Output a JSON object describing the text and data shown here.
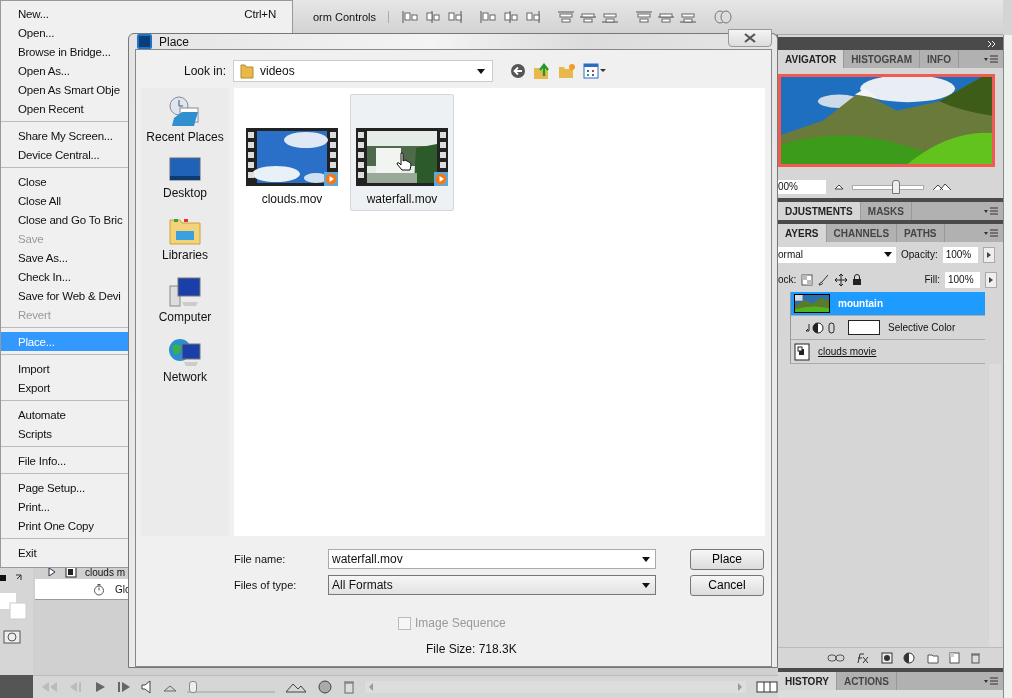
{
  "options_bar": {
    "label": "orm Controls"
  },
  "file_menu": {
    "groups": [
      [
        {
          "label": "New...",
          "shortcut": "Ctrl+N",
          "disabled": false,
          "selected": false
        },
        {
          "label": "Open...",
          "disabled": false,
          "selected": false
        },
        {
          "label": "Browse in Bridge...",
          "disabled": false,
          "selected": false
        },
        {
          "label": "Open As...",
          "disabled": false,
          "selected": false
        },
        {
          "label": "Open As Smart Obje",
          "disabled": false,
          "selected": false
        },
        {
          "label": "Open Recent",
          "disabled": false,
          "selected": false
        }
      ],
      [
        {
          "label": "Share My Screen...",
          "disabled": false,
          "selected": false
        },
        {
          "label": "Device Central...",
          "disabled": false,
          "selected": false
        }
      ],
      [
        {
          "label": "Close",
          "disabled": false,
          "selected": false
        },
        {
          "label": "Close All",
          "disabled": false,
          "selected": false
        },
        {
          "label": "Close and Go To Bric",
          "disabled": false,
          "selected": false
        },
        {
          "label": "Save",
          "disabled": true,
          "selected": false
        },
        {
          "label": "Save As...",
          "disabled": false,
          "selected": false
        },
        {
          "label": "Check In...",
          "disabled": false,
          "selected": false
        },
        {
          "label": "Save for Web & Devi",
          "disabled": false,
          "selected": false
        },
        {
          "label": "Revert",
          "disabled": true,
          "selected": false
        }
      ],
      [
        {
          "label": "Place...",
          "disabled": false,
          "selected": true
        }
      ],
      [
        {
          "label": "Import",
          "disabled": false,
          "selected": false
        },
        {
          "label": "Export",
          "disabled": false,
          "selected": false
        }
      ],
      [
        {
          "label": "Automate",
          "disabled": false,
          "selected": false
        },
        {
          "label": "Scripts",
          "disabled": false,
          "selected": false
        }
      ],
      [
        {
          "label": "File Info...",
          "disabled": false,
          "selected": false
        }
      ],
      [
        {
          "label": "Page Setup...",
          "disabled": false,
          "selected": false
        },
        {
          "label": "Print...",
          "disabled": false,
          "selected": false
        },
        {
          "label": "Print One Copy",
          "disabled": false,
          "selected": false
        }
      ],
      [
        {
          "label": "Exit",
          "disabled": false,
          "selected": false
        }
      ]
    ]
  },
  "dialog": {
    "title": "Place",
    "look_in_label": "Look in:",
    "look_in": "videos",
    "places": [
      {
        "label": "Recent Places",
        "kind": "recent"
      },
      {
        "label": "Desktop",
        "kind": "desktop"
      },
      {
        "label": "Libraries",
        "kind": "libraries"
      },
      {
        "label": "Computer",
        "kind": "computer"
      },
      {
        "label": "Network",
        "kind": "network"
      }
    ],
    "files": [
      {
        "name": "clouds.mov",
        "kind": "clouds",
        "selected": false
      },
      {
        "name": "waterfall.mov",
        "kind": "waterfall",
        "selected": true
      }
    ],
    "file_name_label": "File name:",
    "file_name": "waterfall.mov",
    "file_type_label": "Files of type:",
    "file_type": "All Formats",
    "buttons": [
      {
        "label": "Place"
      },
      {
        "label": "Cancel"
      }
    ],
    "image_sequence": {
      "label": "Image Sequence",
      "checked": false,
      "disabled": true
    },
    "file_size": "File Size: 718.3K"
  },
  "navigator": {
    "tabs": [
      {
        "label": "AVIGATOR",
        "selected": true
      },
      {
        "label": "HISTOGRAM",
        "selected": false
      },
      {
        "label": "INFO",
        "selected": false
      }
    ],
    "zoom": "00%",
    "level": 0.6
  },
  "adjustments": {
    "tabs": [
      {
        "label": "DJUSTMENTS",
        "selected": true
      },
      {
        "label": "MASKS",
        "selected": false
      }
    ]
  },
  "layers_panel": {
    "tabs": [
      {
        "label": "AYERS",
        "selected": true
      },
      {
        "label": "CHANNELS",
        "selected": false
      },
      {
        "label": "PATHS",
        "selected": false
      }
    ],
    "blend_mode": "ormal",
    "opacity_label": "Opacity:",
    "opacity": "100%",
    "lock_label": "ock:",
    "fill_label": "Fill:",
    "fill": "100%",
    "layers": [
      {
        "name": "mountain",
        "kind": "pixel",
        "selected": true
      },
      {
        "name": "Selective Color",
        "kind": "adjustment",
        "selected": false
      },
      {
        "name": "clouds movie",
        "kind": "smart",
        "selected": false
      }
    ]
  },
  "history": {
    "tabs": [
      {
        "label": "HISTORY",
        "selected": true
      },
      {
        "label": "ACTIONS",
        "selected": false
      }
    ]
  },
  "timeline": {
    "layer": "clouds m",
    "property": "Glo",
    "level": 0.02
  }
}
